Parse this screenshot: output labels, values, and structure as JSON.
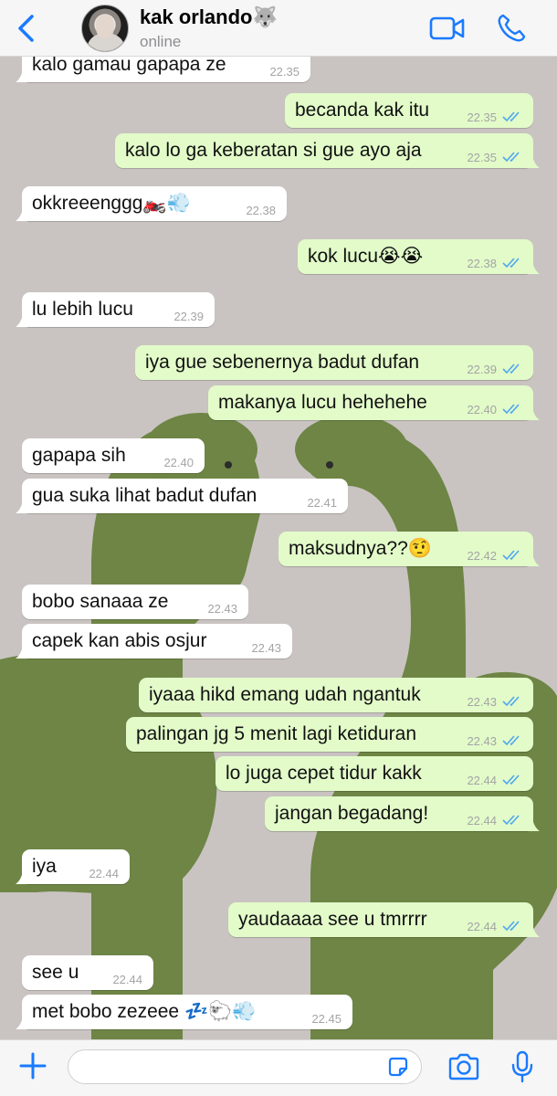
{
  "header": {
    "contact_name": "kak orlando🐺",
    "status": "online",
    "accent_color": "#1a7aff",
    "icons": [
      "back-chevron-icon",
      "video-call-icon",
      "phone-icon"
    ]
  },
  "messages": [
    {
      "dir": "in",
      "text": "kalo gamau gapapa ze",
      "time": "22.35"
    },
    {
      "dir": "out",
      "text": "becanda kak itu",
      "time": "22.35"
    },
    {
      "dir": "out",
      "text": "kalo lo ga keberatan si gue ayo aja",
      "time": "22.35"
    },
    {
      "dir": "in",
      "text": "okkreeenggg🏍️💨",
      "time": "22.38"
    },
    {
      "dir": "out",
      "text": "kok lucu😭😭",
      "time": "22.38"
    },
    {
      "dir": "in",
      "text": "lu lebih lucu",
      "time": "22.39"
    },
    {
      "dir": "out",
      "text": "iya gue sebenernya badut dufan",
      "time": "22.39"
    },
    {
      "dir": "out",
      "text": "makanya lucu hehehehe",
      "time": "22.40"
    },
    {
      "dir": "in",
      "text": "gapapa sih",
      "time": "22.40"
    },
    {
      "dir": "in",
      "text": "gua suka lihat badut dufan",
      "time": "22.41"
    },
    {
      "dir": "out",
      "text": "maksudnya??🤨",
      "time": "22.42"
    },
    {
      "dir": "in",
      "text": "bobo sanaaa ze",
      "time": "22.43"
    },
    {
      "dir": "in",
      "text": "capek kan abis osjur",
      "time": "22.43"
    },
    {
      "dir": "out",
      "text": "iyaaa hikd emang udah ngantuk",
      "time": "22.43"
    },
    {
      "dir": "out",
      "text": "palingan jg 5 menit lagi ketiduran",
      "time": "22.43"
    },
    {
      "dir": "out",
      "text": "lo juga cepet tidur kakk",
      "time": "22.44"
    },
    {
      "dir": "out",
      "text": "jangan begadang!",
      "time": "22.44"
    },
    {
      "dir": "in",
      "text": "iya",
      "time": "22.44"
    },
    {
      "dir": "out",
      "text": "yaudaaaa see u tmrrrr",
      "time": "22.44"
    },
    {
      "dir": "in",
      "text": "see u",
      "time": "22.44"
    },
    {
      "dir": "in",
      "text": "met bobo zezeee 💤🐑💨",
      "time": "22.45"
    }
  ],
  "input": {
    "placeholder": "",
    "icons": [
      "plus-icon",
      "sticker-icon",
      "camera-icon",
      "microphone-icon"
    ]
  },
  "colors": {
    "incoming_bubble": "#ffffff",
    "outgoing_bubble": "#e2fbc9",
    "read_ticks": "#4fa6f0",
    "wallpaper": "#c9c4c1",
    "dino": "#6e8545"
  }
}
